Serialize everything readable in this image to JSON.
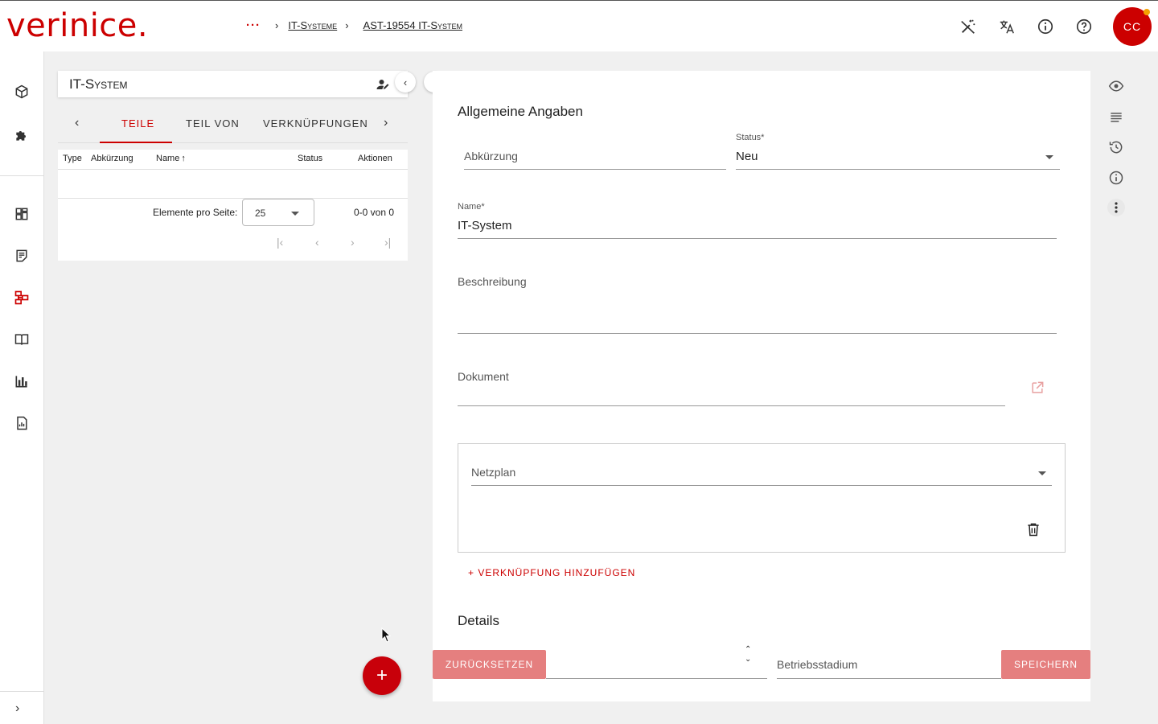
{
  "header": {
    "logo": "verinice.",
    "breadcrumb": {
      "more": "···",
      "items": [
        "IT-Systeme",
        "AST-19554 IT-System"
      ]
    },
    "icons": [
      "magic-wand-off-icon",
      "translate-icon",
      "info-icon",
      "help-icon"
    ],
    "avatar": "CC"
  },
  "sidebar": {
    "items": [
      "cube-icon",
      "puzzle-icon",
      "dashboard-icon",
      "notes-icon",
      "hierarchy-icon",
      "book-icon",
      "bar-chart-icon",
      "report-icon"
    ],
    "expand": "›"
  },
  "left_panel": {
    "title": "IT-System",
    "tabs": {
      "prev": "‹",
      "next": "›",
      "items": [
        "TEILE",
        "TEIL VON",
        "VERKNÜPFUNGEN"
      ],
      "active": "TEILE"
    },
    "table": {
      "columns": [
        "Type",
        "Abkürzung",
        "Name",
        "Status",
        "Aktionen"
      ],
      "sort_indicator": "↑",
      "rows": []
    },
    "paginator": {
      "label": "Elemente pro Seite:",
      "page_size": "25",
      "range": "0-0 von 0",
      "first": "|‹",
      "prev": "‹",
      "next": "›",
      "last": "›|"
    },
    "fab": "+"
  },
  "form": {
    "section_general": "Allgemeine Angaben",
    "abbreviation": {
      "label": "Abkürzung",
      "value": ""
    },
    "status": {
      "label": "Status*",
      "value": "Neu"
    },
    "name": {
      "label": "Name*",
      "value": "IT-System"
    },
    "description": {
      "label": "Beschreibung",
      "value": ""
    },
    "document": {
      "label": "Dokument",
      "value": ""
    },
    "link": {
      "label": "Netzplan",
      "value": ""
    },
    "add_link": "+   VERKNÜPFUNG HINZUFÜGEN",
    "section_details": "Details",
    "betriebsstadium": {
      "label": "Betriebsstadium",
      "value": ""
    },
    "reset_button": "ZURÜCKSETZEN",
    "save_button": "SPEICHERN"
  },
  "right_rail": {
    "icons": [
      "eye-icon",
      "list-icon",
      "history-icon",
      "info-icon",
      "more-vert-icon"
    ]
  },
  "colors": {
    "brand": "#c00000",
    "button_disabled": "#e57f7f"
  }
}
